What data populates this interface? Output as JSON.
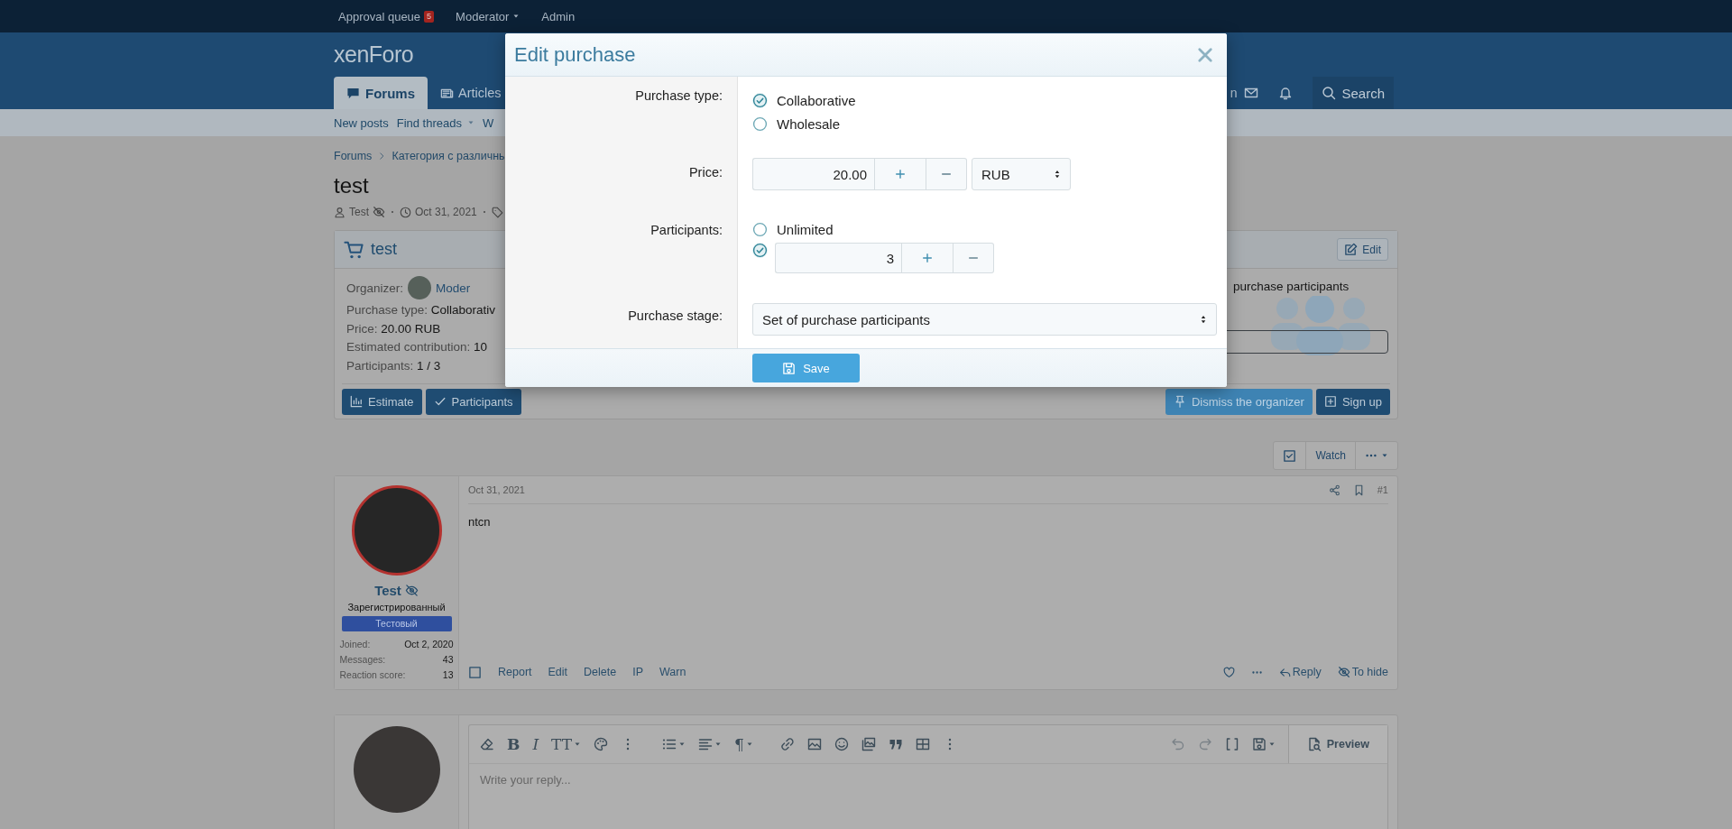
{
  "top_bar": [
    {
      "label": "Approval queue",
      "badge": "5",
      "dropdown": false
    },
    {
      "label": "Moderator",
      "dropdown": true
    },
    {
      "label": "Admin",
      "dropdown": false
    }
  ],
  "header": {
    "logo": "xenForo",
    "tabs": [
      {
        "label": "Forums",
        "selected": true
      },
      {
        "label": "Articles",
        "selected": false
      }
    ],
    "user_name_fragment": "n",
    "search": "Search"
  },
  "sub_nav": [
    {
      "label": "New posts",
      "dropdown": false
    },
    {
      "label": "Find threads",
      "dropdown": true
    },
    {
      "label": "W",
      "dropdown": false
    }
  ],
  "breadcrumb": [
    "Forums",
    "Категория с различны"
  ],
  "thread": {
    "title": "test",
    "author": "Test",
    "date": "Oct 31, 2021"
  },
  "purchase": {
    "title": "test",
    "edit": "Edit",
    "organizer_label": "Organizer:",
    "organizer": "Moder",
    "details": [
      {
        "label": "Purchase type:",
        "value": "Collaborativ"
      },
      {
        "label": "Price:",
        "value": "20.00 RUB"
      },
      {
        "label": "Estimated contribution:",
        "value": "10"
      },
      {
        "label": "Participants:",
        "value": "1 / 3"
      }
    ],
    "stage": "purchase participants",
    "buttons_left": [
      {
        "label": "Estimate",
        "kind": "primary"
      },
      {
        "label": "Participants",
        "kind": "primary"
      }
    ],
    "buttons_right": [
      {
        "label": "Dismiss the organizer",
        "kind": "accent"
      },
      {
        "label": "Sign up",
        "kind": "primary"
      }
    ]
  },
  "thread_tools": {
    "watch": "Watch"
  },
  "post": {
    "date": "Oct 31, 2021",
    "number": "#1",
    "body": "ntcn",
    "author": {
      "name": "Test",
      "title": "Зарегистрированный",
      "banner": "Тестовый",
      "stats": [
        {
          "label": "Joined:",
          "value": "Oct 2, 2020"
        },
        {
          "label": "Messages:",
          "value": "43"
        },
        {
          "label": "Reaction score:",
          "value": "13"
        }
      ]
    },
    "actions": [
      "Report",
      "Edit",
      "Delete",
      "IP",
      "Warn"
    ],
    "reply": "Reply",
    "hide": "To hide"
  },
  "editor": {
    "toolbar_groups": [
      {
        "items": [
          {
            "kind": "eraser",
            "dropdown": false,
            "disabled": false
          },
          {
            "kind": "bold",
            "glyph": "B",
            "dropdown": false,
            "disabled": false
          },
          {
            "kind": "italic",
            "glyph": "I",
            "dropdown": false,
            "disabled": false
          },
          {
            "kind": "text-size",
            "glyph": "TT",
            "dropdown": true,
            "disabled": false
          },
          {
            "kind": "palette",
            "dropdown": false,
            "disabled": false
          },
          {
            "kind": "more",
            "dropdown": false,
            "disabled": false
          }
        ]
      },
      {
        "items": [
          {
            "kind": "list",
            "dropdown": true,
            "disabled": false
          },
          {
            "kind": "align",
            "dropdown": true,
            "disabled": false
          },
          {
            "kind": "paragraph",
            "glyph": "¶",
            "dropdown": true,
            "disabled": false
          }
        ]
      },
      {
        "items": [
          {
            "kind": "link",
            "dropdown": false,
            "disabled": false
          },
          {
            "kind": "image",
            "dropdown": false,
            "disabled": false
          },
          {
            "kind": "smile",
            "dropdown": false,
            "disabled": false
          },
          {
            "kind": "media",
            "dropdown": false,
            "disabled": false
          },
          {
            "kind": "quote",
            "dropdown": false,
            "disabled": false
          },
          {
            "kind": "table",
            "dropdown": false,
            "disabled": false
          },
          {
            "kind": "more",
            "dropdown": false,
            "disabled": false
          }
        ]
      }
    ],
    "toolbar_right": [
      {
        "kind": "undo",
        "dropdown": false,
        "disabled": true
      },
      {
        "kind": "redo",
        "dropdown": false,
        "disabled": true
      },
      {
        "kind": "brackets",
        "dropdown": false,
        "disabled": false
      },
      {
        "kind": "save",
        "dropdown": true,
        "disabled": false
      }
    ],
    "preview": "Preview",
    "placeholder": "Write your reply..."
  },
  "dialog": {
    "title": "Edit purchase",
    "purchase_type": {
      "label": "Purchase type:",
      "options": [
        {
          "label": "Collaborative",
          "selected": true
        },
        {
          "label": "Wholesale",
          "selected": false
        }
      ]
    },
    "price": {
      "label": "Price:",
      "value": "20.00",
      "currency": "RUB"
    },
    "participants": {
      "label": "Participants:",
      "unlimited": {
        "label": "Unlimited",
        "selected": false
      },
      "limit": {
        "value": "3",
        "selected": true
      }
    },
    "stage": {
      "label": "Purchase stage:",
      "value": "Set of purchase participants"
    },
    "save": "Save"
  }
}
